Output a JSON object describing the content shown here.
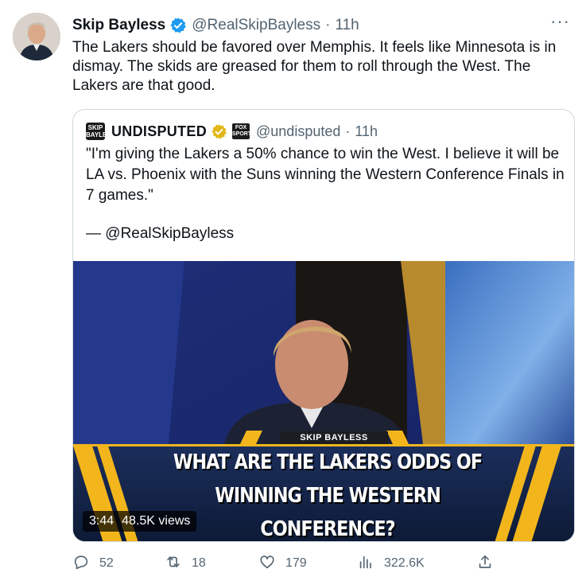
{
  "tweet": {
    "author_name": "Skip Bayless",
    "author_handle": "@RealSkipBayless",
    "separator": "·",
    "time": "11h",
    "more_label": "···",
    "text": "The Lakers should be favored over Memphis. It feels like Minnesota is in dismay. The skids are greased for them to roll through the West. The Lakers are that good."
  },
  "quote": {
    "logo_text": "SKIP BAYLESS",
    "account_name": "UNDISPUTED",
    "network_badge": "FOX SPORTS",
    "handle": "@undisputed",
    "separator": "·",
    "time": "11h",
    "text": "\"I'm giving the Lakers a 50% chance to win the West. I believe it will be LA vs. Phoenix with the Suns winning the Western Conference Finals in 7 games.\"",
    "attribution": "— @RealSkipBayless"
  },
  "video": {
    "lower_third_label": "SKIP BAYLESS",
    "headline": "WHAT ARE THE LAKERS ODDS OF WINNING THE WESTERN CONFERENCE?",
    "duration": "3:44",
    "views": "48.5K views"
  },
  "actions": {
    "replies": "52",
    "retweets": "18",
    "likes": "179",
    "views": "322.6K"
  },
  "colors": {
    "verified_blue": "#1d9bf0",
    "verified_gold": "#e2b719",
    "muted_text": "#536471",
    "border": "#cfd9de",
    "banner_gold": "#f2b61c"
  },
  "icons": [
    "verified-badge-icon",
    "gold-verified-badge-icon",
    "more-icon",
    "reply-icon",
    "retweet-icon",
    "like-icon",
    "views-icon",
    "share-icon"
  ]
}
